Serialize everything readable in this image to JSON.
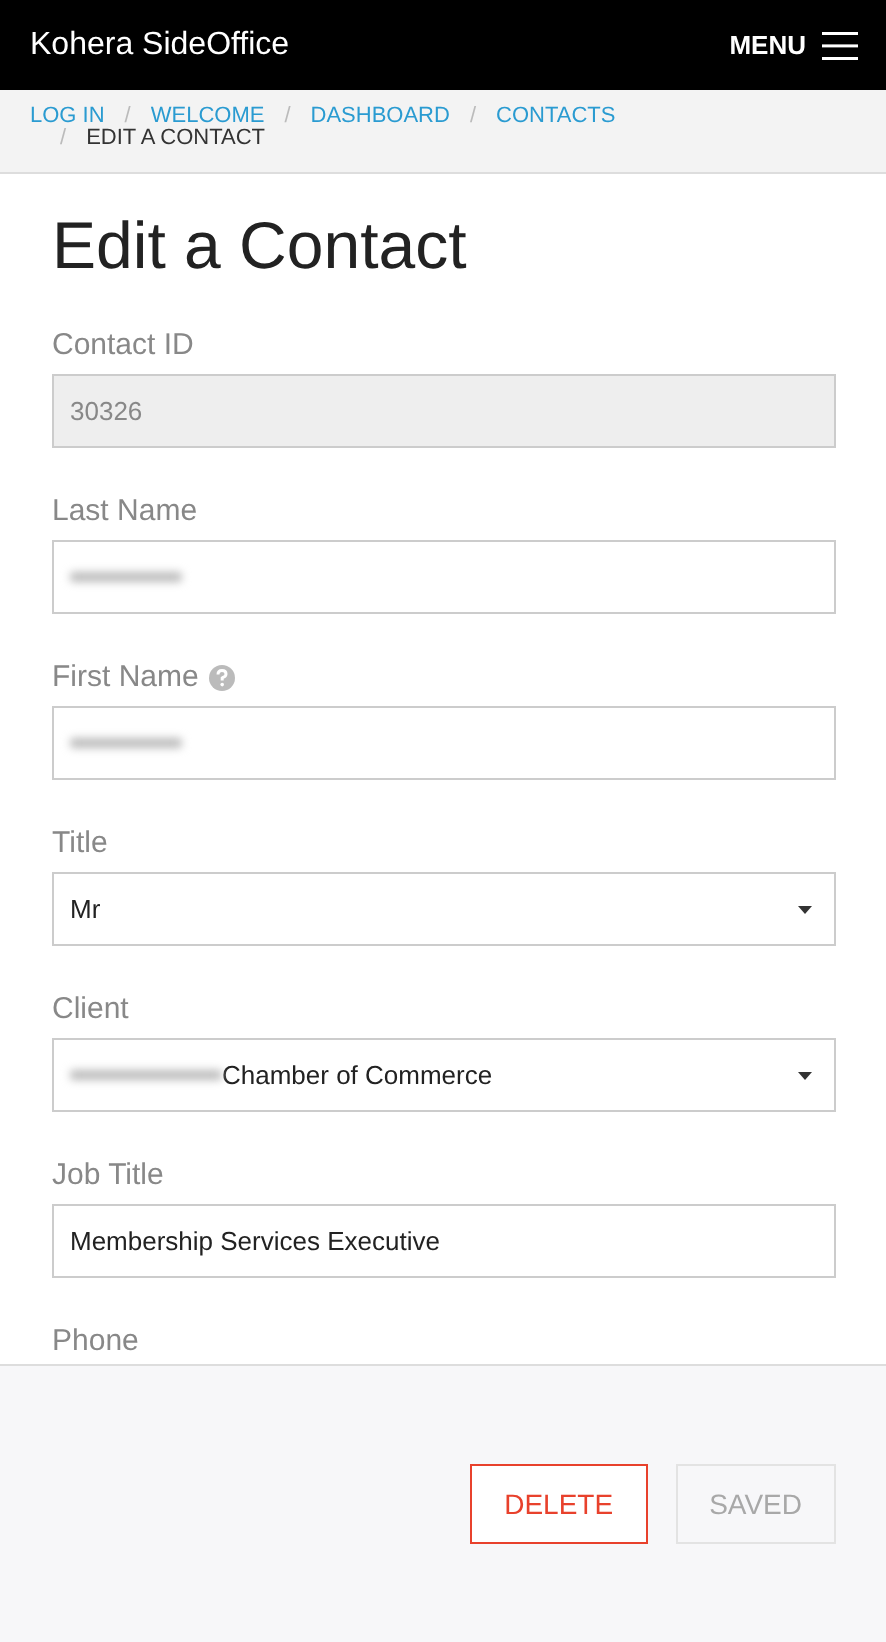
{
  "header": {
    "title": "Kohera SideOffice",
    "menu_label": "MENU"
  },
  "breadcrumb": {
    "separator": "/",
    "items": [
      {
        "label": "LOG IN",
        "current": false
      },
      {
        "label": "WELCOME",
        "current": false
      },
      {
        "label": "DASHBOARD",
        "current": false
      },
      {
        "label": "CONTACTS",
        "current": false
      },
      {
        "label": "EDIT A CONTACT",
        "current": true
      }
    ]
  },
  "page_title": "Edit a Contact",
  "fields": [
    {
      "kind": "readonly",
      "label": "Contact ID",
      "value": "30326"
    },
    {
      "kind": "text",
      "label": "Last Name",
      "blurred": true
    },
    {
      "kind": "text",
      "label": "First Name",
      "help": true,
      "blurred": true
    },
    {
      "kind": "select",
      "label": "Title",
      "value": "Mr"
    },
    {
      "kind": "select",
      "label": "Client",
      "value": "Chamber of Commerce",
      "blurred": true
    },
    {
      "kind": "text",
      "label": "Job Title",
      "value": "Membership Services Executive"
    },
    {
      "kind": "label",
      "label": "Phone"
    }
  ],
  "buttons": [
    {
      "label": "DELETE",
      "kind": "danger",
      "disabled": false
    },
    {
      "label": "SAVED",
      "kind": "primary",
      "disabled": true
    }
  ]
}
